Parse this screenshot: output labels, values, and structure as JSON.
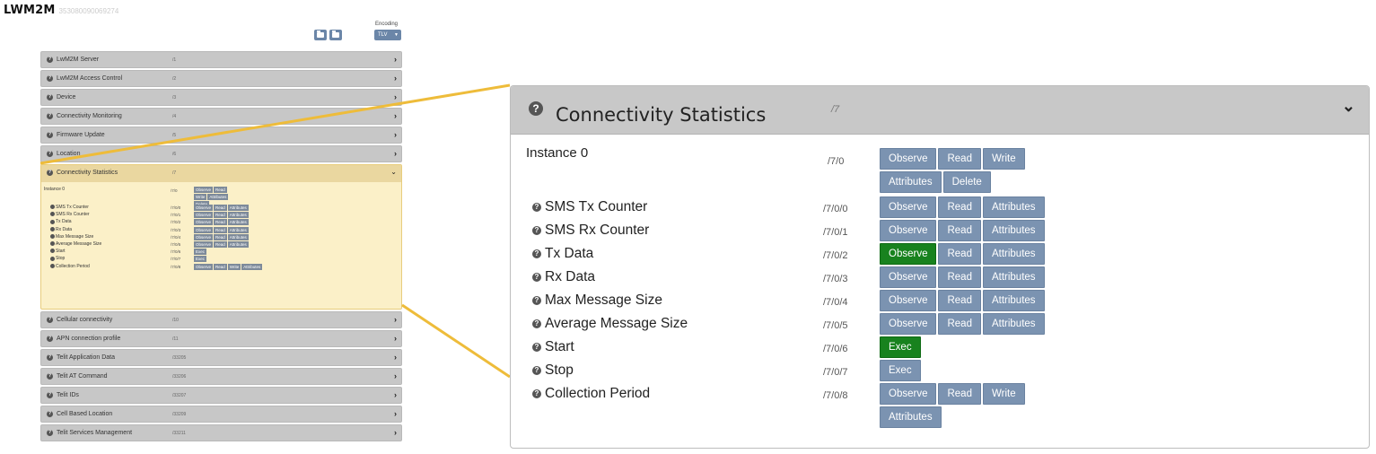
{
  "app": {
    "title": "LWM2M",
    "subtitle": "353080090069274"
  },
  "toolbar": {
    "encoding_label": "Encoding",
    "encoding_value": "TLV"
  },
  "objects": [
    {
      "name": "LwM2M Server",
      "path": "/1"
    },
    {
      "name": "LwM2M Access Control",
      "path": "/2"
    },
    {
      "name": "Device",
      "path": "/3"
    },
    {
      "name": "Connectivity Monitoring",
      "path": "/4"
    },
    {
      "name": "Firmware Update",
      "path": "/5"
    },
    {
      "name": "Location",
      "path": "/6"
    },
    {
      "name": "Connectivity Statistics",
      "path": "/7"
    },
    {
      "name": "Cellular connectivity",
      "path": "/10"
    },
    {
      "name": "APN connection profile",
      "path": "/11"
    },
    {
      "name": "Telit Application Data",
      "path": "/33205"
    },
    {
      "name": "Telit AT Command",
      "path": "/33206"
    },
    {
      "name": "Telit IDs",
      "path": "/33207"
    },
    {
      "name": "Cell Based Location",
      "path": "/33209"
    },
    {
      "name": "Telit Services Management",
      "path": "/33211"
    }
  ],
  "panel": {
    "title": "Connectivity Statistics",
    "path": "/7",
    "instance": {
      "label": "Instance 0",
      "path": "/7/0"
    },
    "instance_buttons": [
      "Observe",
      "Read",
      "Write",
      "Attributes",
      "Delete"
    ],
    "resources": [
      {
        "name": "SMS Tx Counter",
        "path": "/7/0/0",
        "buttons": [
          "Observe",
          "Read",
          "Attributes"
        ]
      },
      {
        "name": "SMS Rx Counter",
        "path": "/7/0/1",
        "buttons": [
          "Observe",
          "Read",
          "Attributes"
        ]
      },
      {
        "name": "Tx Data",
        "path": "/7/0/2",
        "buttons": [
          "Observe",
          "Read",
          "Attributes"
        ],
        "active": "Observe"
      },
      {
        "name": "Rx Data",
        "path": "/7/0/3",
        "buttons": [
          "Observe",
          "Read",
          "Attributes"
        ]
      },
      {
        "name": "Max Message Size",
        "path": "/7/0/4",
        "buttons": [
          "Observe",
          "Read",
          "Attributes"
        ]
      },
      {
        "name": "Average Message Size",
        "path": "/7/0/5",
        "buttons": [
          "Observe",
          "Read",
          "Attributes"
        ]
      },
      {
        "name": "Start",
        "path": "/7/0/6",
        "buttons": [
          "Exec"
        ],
        "active": "Exec"
      },
      {
        "name": "Stop",
        "path": "/7/0/7",
        "buttons": [
          "Exec"
        ]
      },
      {
        "name": "Collection Period",
        "path": "/7/0/8",
        "buttons": [
          "Observe",
          "Read",
          "Write",
          "Attributes"
        ]
      }
    ]
  },
  "colors": {
    "button": "#7b93b1",
    "active_button": "#18821e",
    "highlight": "#fbf0c8",
    "connector": "#eebc3a"
  }
}
